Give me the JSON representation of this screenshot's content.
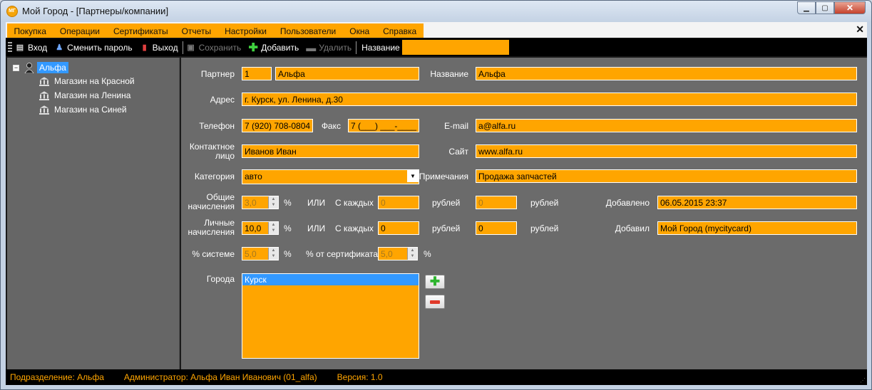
{
  "window": {
    "title": "Мой Город - [Партнеры/компании]",
    "app_icon_text": "МГ"
  },
  "menu": [
    "Покупка",
    "Операции",
    "Сертификаты",
    "Отчеты",
    "Настройки",
    "Пользователи",
    "Окна",
    "Справка"
  ],
  "toolbar": {
    "login": "Вход",
    "change_password": "Сменить пароль",
    "logout": "Выход",
    "save": "Сохранить",
    "add": "Добавить",
    "delete": "Удалить",
    "search_label": "Название",
    "search_value": ""
  },
  "tree": {
    "root": "Альфа",
    "children": [
      "Магазин на Красной",
      "Магазин на Ленина",
      "Магазин на Синей"
    ]
  },
  "form": {
    "partner_label": "Партнер",
    "partner_id": "1",
    "partner_name": "Альфа",
    "title_label": "Название",
    "title_value": "Альфа",
    "address_label": "Адрес",
    "address_value": "г. Курск, ул. Ленина, д.30",
    "phone_label": "Телефон",
    "phone_value": "7 (920) 708-0804",
    "fax_label": "Факс",
    "fax_value": "7 (___) ___-____",
    "email_label": "E-mail",
    "email_value": "a@alfa.ru",
    "contact_label": "Контактное лицо",
    "contact_value": "Иванов Иван",
    "site_label": "Сайт",
    "site_value": "www.alfa.ru",
    "category_label": "Категория",
    "category_value": "авто",
    "notes_label": "Примечания",
    "notes_value": "Продажа запчастей",
    "general_label": "Общие начисления",
    "general_value": "3,0",
    "personal_label": "Личные начисления",
    "personal_value": "10,0",
    "percent": "%",
    "or": "ИЛИ",
    "every": "С каждых",
    "rubles": "рублей",
    "general_every": "0",
    "general_rub": "0",
    "personal_every": "0",
    "personal_rub": "0",
    "added_label": "Добавлено",
    "added_value": "06.05.2015 23:37",
    "added_by_label": "Добавил",
    "added_by_value": "Мой Город (mycitycard)",
    "system_label": "% системе",
    "system_value": "5,0",
    "cert_label": "% от сертификата",
    "cert_value": "5,0",
    "cities_label": "Города",
    "cities": [
      "Курск"
    ]
  },
  "status": {
    "division": "Подразделение: Альфа",
    "admin": "Администратор: Альфа Иван Иванович (01_alfa)",
    "version": "Версия: 1.0"
  },
  "colors": {
    "accent": "#ffa500",
    "selection": "#3399ff",
    "panel": "#6b6b6b",
    "bar": "#000000"
  }
}
